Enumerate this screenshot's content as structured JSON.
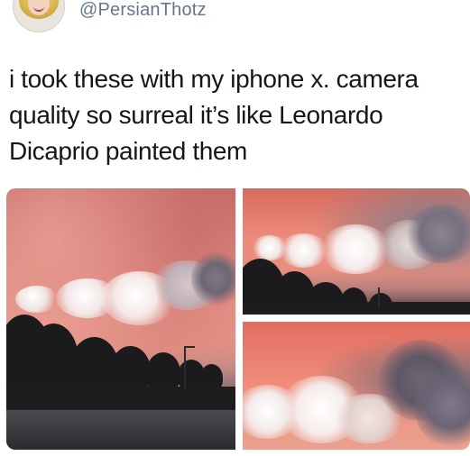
{
  "tweet": {
    "handle": "@PersianThotz",
    "text": "i took these with my iphone x. camera quality so surreal it’s like Leonardo Dicaprio painted them"
  },
  "photos": {
    "count": 3,
    "icons": [
      "avatar-icon"
    ]
  }
}
